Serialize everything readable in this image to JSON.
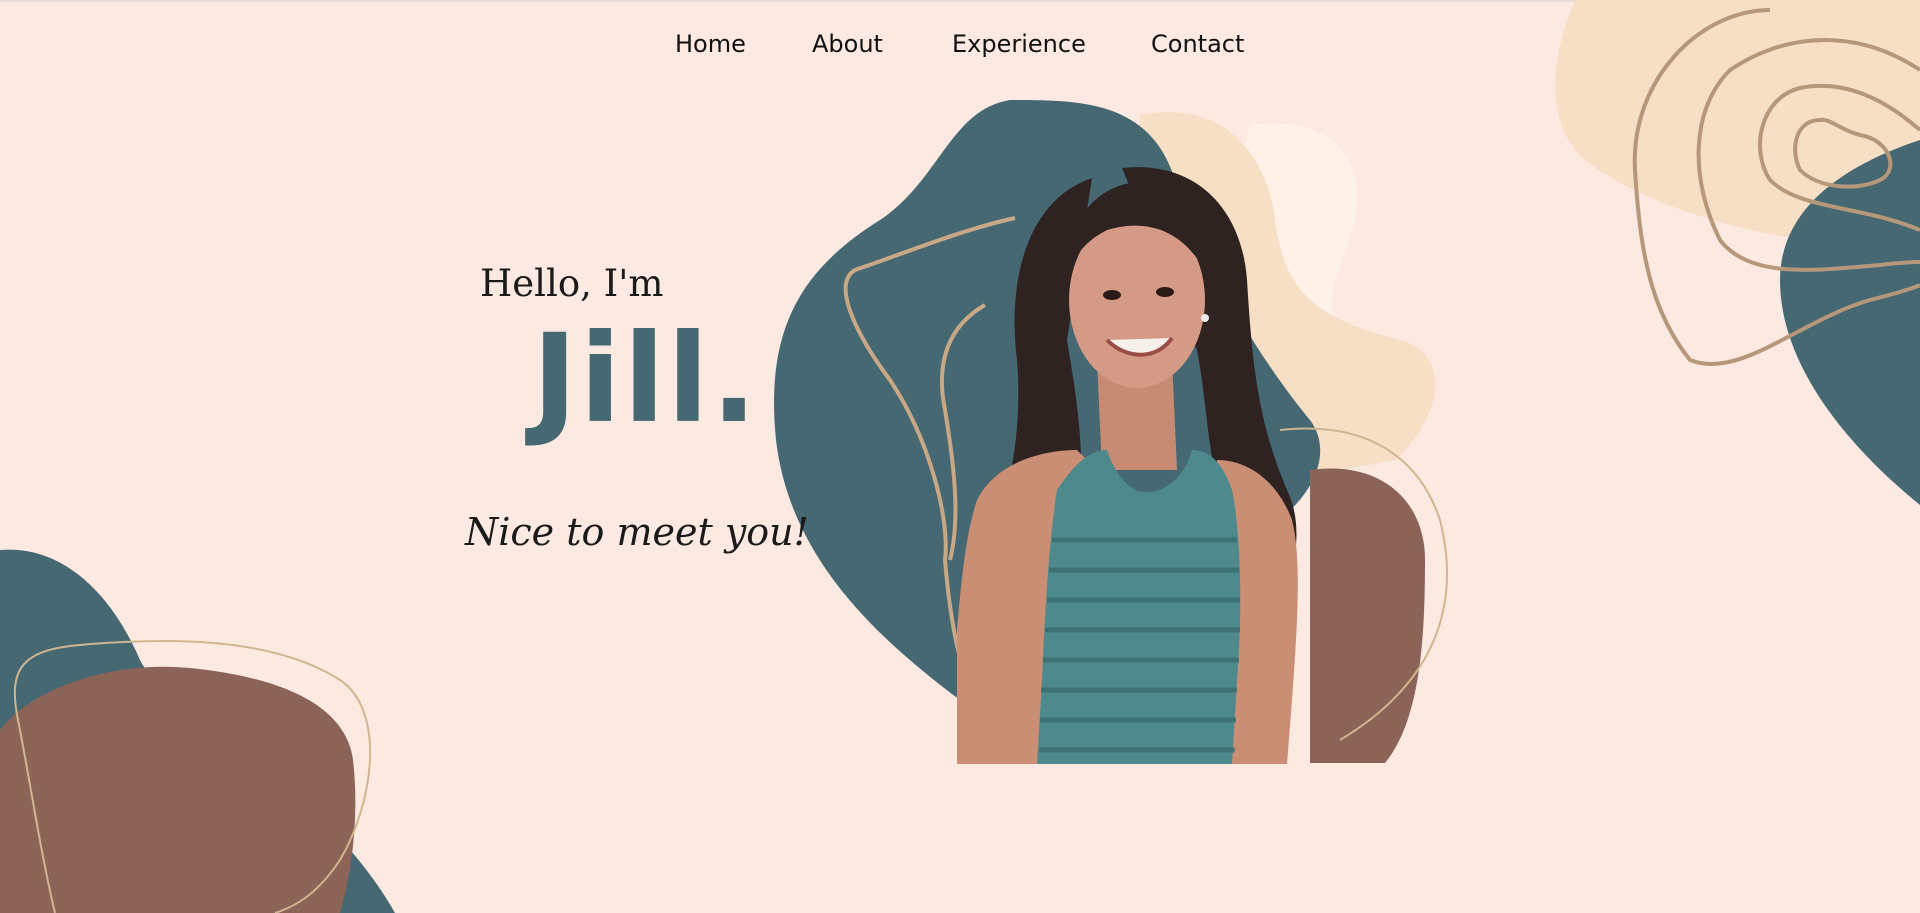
{
  "nav": {
    "items": [
      {
        "label": "Home"
      },
      {
        "label": "About"
      },
      {
        "label": "Experience"
      },
      {
        "label": "Contact"
      }
    ]
  },
  "hero": {
    "greeting": "Hello, I'm",
    "name": "Jill.",
    "tagline": "Nice to meet you!"
  },
  "colors": {
    "background": "#fce9e1",
    "teal": "#456873",
    "brown": "#8b6357",
    "sand": "#f7dfc6",
    "line": "#b7977a"
  }
}
